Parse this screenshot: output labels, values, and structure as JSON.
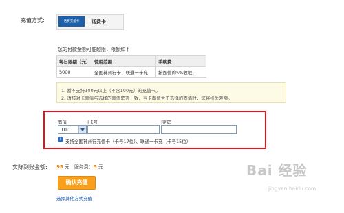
{
  "pay_method": {
    "label": "充值方式:",
    "card_thumb_text": "话费充值卡",
    "card_name": "话费卡"
  },
  "limit_notice": "您的付款金额可能超限，限额如下",
  "limits_table": {
    "headers": [
      "每日限额（元）",
      "使用范围",
      "手续费"
    ],
    "rows": [
      [
        "5000",
        "全国神州行卡、联通一卡充",
        "按面值的5%收取。"
      ]
    ]
  },
  "warnings": [
    "1.  暂不支持100元以上（不含100元）的充值卡。",
    "2.  请核对卡面值与选择的面值是否一致，当卡面值大于选择的面值时，您将损失差额。"
  ],
  "form": {
    "denomination_label": "面值",
    "denomination_value": "100",
    "card_number_label": "卡号",
    "card_number_value": "",
    "password_label": "密码",
    "password_value": "",
    "info_text": "支持全国神州行充值卡（卡号17位）、联通一卡充（卡号15位）"
  },
  "summary": {
    "label": "实际到账金额:",
    "amount": "95",
    "amount_unit": "元",
    "separator": "|",
    "fee_label": "服务费：",
    "fee": "5",
    "fee_unit": "元"
  },
  "confirm_button": "确认充值",
  "other_methods_link": "选择其他方式充值",
  "watermark": {
    "main": "Bai 经验",
    "sub": "jingyan.baidu.com"
  },
  "colors": {
    "highlight_border": "#e3151c",
    "button": "#f8a01e",
    "amount": "#f08000",
    "link": "#1a5bb8"
  }
}
